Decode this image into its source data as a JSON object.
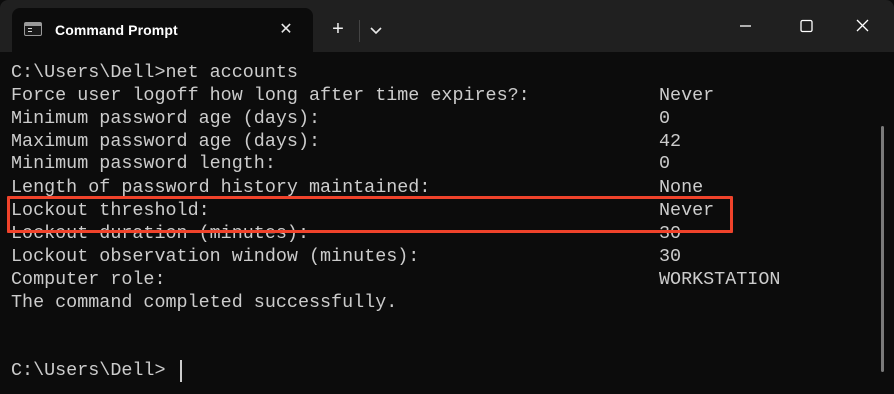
{
  "window": {
    "tab_title": "Command Prompt",
    "tab_close_glyph": "✕",
    "new_tab_glyph": "+"
  },
  "terminal": {
    "lines": [
      "C:\\Users\\Dell>net accounts",
      "Force user logoff how long after time expires?:",
      "Minimum password age (days):",
      "Maximum password age (days):",
      "Minimum password length:",
      "Length of password history maintained:",
      "Lockout threshold:",
      "Lockout duration (minutes):",
      "Lockout observation window (minutes):",
      "Computer role:",
      "The command completed successfully.",
      "",
      "C:\\Users\\Dell>"
    ],
    "values": [
      "",
      "Never",
      "0",
      "42",
      "0",
      "None",
      "Never",
      "30",
      "30",
      "WORKSTATION",
      "",
      "",
      ""
    ]
  },
  "colors": {
    "background": "#0c0c0c",
    "titlebar": "#202020",
    "text": "#cccccc",
    "highlight_border": "#f0432b"
  },
  "icons": {
    "tab": "terminal-icon",
    "close": "close-icon",
    "add": "plus-icon",
    "dropdown": "chevron-down-icon",
    "minimize": "minimize-icon",
    "maximize": "maximize-icon",
    "window_close": "close-icon"
  }
}
